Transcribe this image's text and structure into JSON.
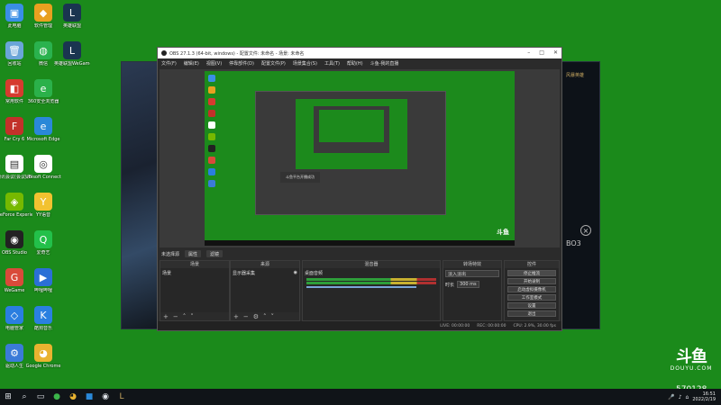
{
  "desktop_icons": [
    {
      "label": "此电脑",
      "color": "#3a8ee6",
      "glyph": "▣"
    },
    {
      "label": "回收站",
      "color": "#6aa5d8",
      "glyph": "🗑"
    },
    {
      "label": "常用软件",
      "color": "#d63b2f",
      "glyph": "◧"
    },
    {
      "label": "Far Cry 6",
      "color": "#c2312a",
      "glyph": "F"
    },
    {
      "label": "腾讯会议(会议)(64位)",
      "color": "#ffffff",
      "glyph": "▤"
    },
    {
      "label": "GeForce Experience",
      "color": "#76b900",
      "glyph": "◈"
    },
    {
      "label": "OBS Studio",
      "color": "#222222",
      "glyph": "◉"
    },
    {
      "label": "WeGame",
      "color": "#d94a3a",
      "glyph": "G"
    },
    {
      "label": "电脑管家",
      "color": "#2a7ee0",
      "glyph": "◇"
    },
    {
      "label": "驱动人生",
      "color": "#3b7bd8",
      "glyph": "⚙"
    }
  ],
  "desktop_icons_col2": [
    {
      "label": "软件管理",
      "color": "#e8a020",
      "glyph": "◆"
    },
    {
      "label": "微信",
      "color": "#2ab24e",
      "glyph": "◍"
    },
    {
      "label": "360安全浏览器",
      "color": "#2bb14a",
      "glyph": "e"
    },
    {
      "label": "Microsoft Edge",
      "color": "#2a88d8",
      "glyph": "e"
    },
    {
      "label": "Ubisoft Connect",
      "color": "#ffffff",
      "glyph": "◎"
    },
    {
      "label": "YY语音",
      "color": "#f2c230",
      "glyph": "Y"
    },
    {
      "label": "爱奇艺",
      "color": "#23c04a",
      "glyph": "Q"
    },
    {
      "label": "哔哩哔哩",
      "color": "#2b6fd6",
      "glyph": "▶"
    },
    {
      "label": "酷狗音乐",
      "color": "#2a80e0",
      "glyph": "K"
    },
    {
      "label": "Google Chrome",
      "color": "#e9b330",
      "glyph": "◕"
    }
  ],
  "desktop_icons_col3": [
    {
      "label": "英雄联盟",
      "color": "#1a3550",
      "glyph": "L"
    },
    {
      "label": "英雄联盟WeGame版",
      "color": "#1a3550",
      "glyph": "L"
    }
  ],
  "obs": {
    "title": "OBS 27.1.3 (64-bit, windows) - 配置文件: 未命名 - 场景: 未命名",
    "menu": [
      "文件(F)",
      "编辑(E)",
      "视图(V)",
      "停靠部件(D)",
      "配置文件(P)",
      "场景集合(S)",
      "工具(T)",
      "帮助(H)",
      "斗鱼-我的直播"
    ],
    "toast": "斗鱼平台开播成功",
    "source_name": "未选择源",
    "filter_tab": "属性",
    "filter_tab2": "滤镜",
    "scenes_header": "场景",
    "scene_item": "场景",
    "sources_header": "来源",
    "source_item": "显示器采集",
    "mixer_header": "混音器",
    "mixer_item": "桌面音频",
    "transitions_header": "转场特效",
    "transition_value": "淡入淡出",
    "duration_label": "时长",
    "duration_value": "300 ms",
    "controls_header": "控件",
    "controls": [
      "停止推流",
      "开始录制",
      "启动虚拟摄像机",
      "工作室模式",
      "设置",
      "退出"
    ],
    "status": [
      "LIVE: 00:00:00",
      "REC: 00:00:00",
      "CPU: 2.9%, 30.00 fps"
    ]
  },
  "game_panel": {
    "items": [
      "风暴英雄",
      "BO3"
    ]
  },
  "douyu": {
    "logo": "斗鱼",
    "sub": "DOUYU.COM",
    "room": "570128"
  },
  "taskbar": {
    "time": "16:51",
    "date": "2022/2/19"
  }
}
